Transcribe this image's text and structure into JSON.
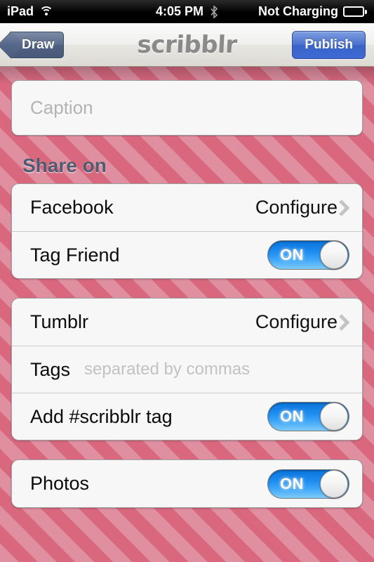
{
  "status_bar": {
    "carrier": "iPad",
    "wifi_icon": "wifi-icon",
    "time": "4:05 PM",
    "bluetooth_icon": "bluetooth-icon",
    "battery_text": "Not Charging",
    "battery_icon": "battery-icon"
  },
  "nav": {
    "back_label": "Draw",
    "title": "scribblr",
    "publish_label": "Publish"
  },
  "caption": {
    "value": "",
    "placeholder": "Caption"
  },
  "sections": {
    "share_on_header": "Share on"
  },
  "facebook_group": {
    "rows": [
      {
        "label": "Facebook",
        "action": "Configure",
        "chevron": "chevron-right-icon"
      },
      {
        "label": "Tag Friend",
        "toggle": "ON"
      }
    ]
  },
  "tumblr_group": {
    "rows": [
      {
        "label": "Tumblr",
        "action": "Configure",
        "chevron": "chevron-right-icon"
      },
      {
        "label": "Tags",
        "value": "",
        "placeholder": "separated by commas"
      },
      {
        "label": "Add #scribblr tag",
        "toggle": "ON"
      }
    ]
  },
  "photos_group": {
    "rows": [
      {
        "label": "Photos",
        "toggle": "ON"
      }
    ]
  },
  "colors": {
    "stripe_light": "#e08fa1",
    "stripe_dark": "#d9687f",
    "switch_on": "#1d8cf0",
    "publish_blue": "#4b73cf",
    "header_text": "#4f5b70"
  }
}
